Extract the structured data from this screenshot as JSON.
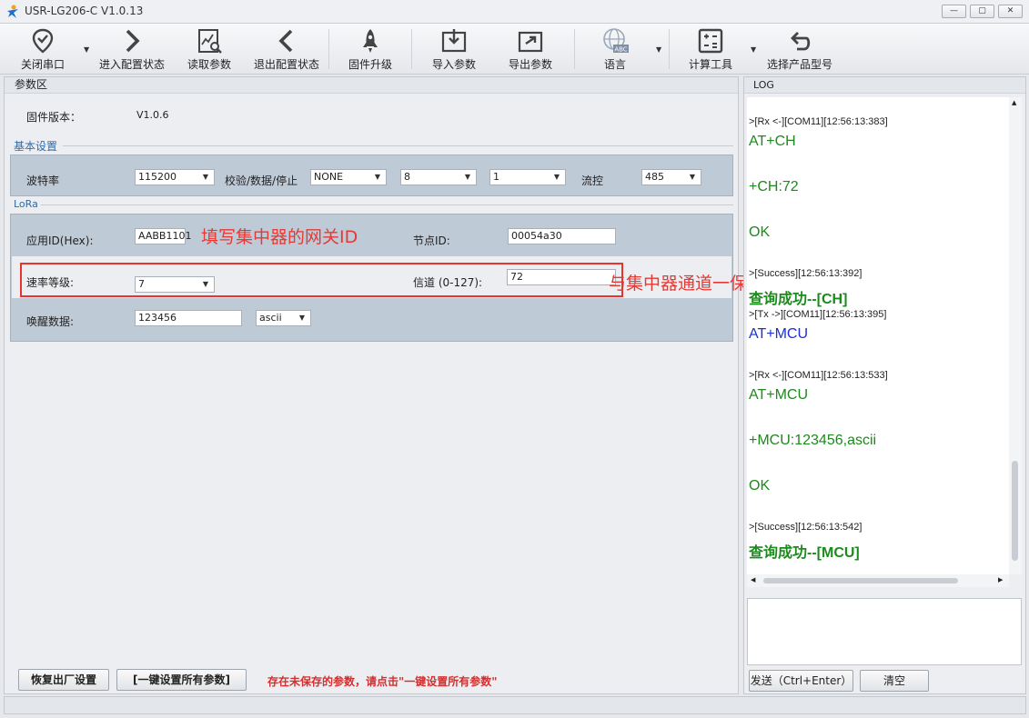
{
  "window": {
    "title": "USR-LG206-C  V1.0.13",
    "controls": [
      "—",
      "▢",
      "✕"
    ]
  },
  "toolbar": {
    "close_port": "关闭串口",
    "enter_config": "进入配置状态",
    "read_params": "读取参数",
    "exit_config": "退出配置状态",
    "firmware_upgrade": "固件升级",
    "import_params": "导入参数",
    "export_params": "导出参数",
    "language": "语言",
    "language_badge": "ABC",
    "calc_tools": "计算工具",
    "select_model": "选择产品型号"
  },
  "params": {
    "panel_title": "参数区",
    "firmware_label": "固件版本：",
    "firmware_value": "V1.0.6",
    "basic_title": "基本设置",
    "baud_label": "波特率",
    "baud_value": "115200",
    "parity_label": "校验/数据/停止",
    "parity_value": "NONE",
    "data_bits": "8",
    "stop_bits": "1",
    "flow_label": "流控",
    "flow_value": "485",
    "lora_title": "LoRa",
    "appid_label": "应用ID(Hex):",
    "appid_value": "AABB1101",
    "node_label": "节点ID:",
    "node_value": "00054a30",
    "rate_label": "速率等级:",
    "rate_value": "7",
    "channel_label": "信道 (0-127):",
    "channel_value": "72",
    "wake_label": "唤醒数据:",
    "wake_value": "123456",
    "wake_format": "ascii"
  },
  "annotations": {
    "appid_note": "填写集中器的网关ID",
    "channel_note": "与集中器通道一保持一致"
  },
  "footer": {
    "factory_reset": "恢复出厂设置",
    "set_all": "[一键设置所有参数]",
    "warning": "存在未保存的参数，请点击\"一键设置所有参数\""
  },
  "log": {
    "title": "LOG",
    "entries": {
      "e1": ">[Rx <-][COM11][12:56:13:383]",
      "e2": "AT+CH",
      "e3": "+CH:72",
      "e4": "OK",
      "e5": ">[Success][12:56:13:392]",
      "e6": "查询成功--[CH]",
      "e7": ">[Tx ->][COM11][12:56:13:395]",
      "e8": "AT+MCU",
      "e9": ">[Rx <-][COM11][12:56:13:533]",
      "e10": "AT+MCU",
      "e11": "+MCU:123456,ascii",
      "e12": "OK",
      "e13": ">[Success][12:56:13:542]",
      "e14": "查询成功--[MCU]"
    },
    "send_button": "发送（Ctrl+Enter）",
    "clear_button": "清空"
  },
  "colors": {
    "accent": "#2f6aa8",
    "log_green": "#1c8a1c",
    "log_blue": "#1b2fd3",
    "annotation_red": "#e53935"
  }
}
